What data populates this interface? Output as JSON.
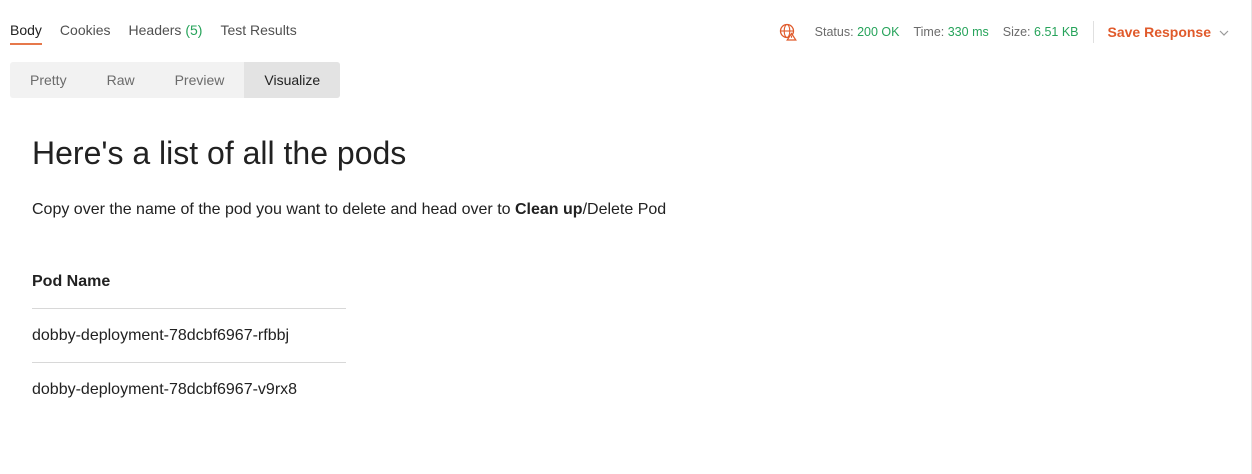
{
  "response_tabs": [
    {
      "label": "Body",
      "active": true
    },
    {
      "label": "Cookies",
      "active": false
    },
    {
      "label": "Headers",
      "count": "(5)",
      "active": false
    },
    {
      "label": "Test Results",
      "active": false
    }
  ],
  "status": {
    "status_label": "Status:",
    "status_value": "200 OK",
    "time_label": "Time:",
    "time_value": "330 ms",
    "size_label": "Size:",
    "size_value": "6.51 KB",
    "icon": "globe-warning-icon"
  },
  "save_response": {
    "label": "Save Response",
    "icon": "chevron-down-icon"
  },
  "view_tabs": [
    {
      "label": "Pretty",
      "active": false
    },
    {
      "label": "Raw",
      "active": false
    },
    {
      "label": "Preview",
      "active": false
    },
    {
      "label": "Visualize",
      "active": true
    }
  ],
  "visualization": {
    "heading": "Here's a list of all the pods",
    "description_prefix": "Copy over the name of the pod you want to delete and head over to ",
    "description_bold": "Clean up",
    "description_suffix": "/Delete Pod",
    "table": {
      "header": "Pod Name",
      "rows": [
        "dobby-deployment-78dcbf6967-rfbbj",
        "dobby-deployment-78dcbf6967-v9rx8"
      ]
    }
  },
  "colors": {
    "accent": "#e05a2b",
    "success": "#26a35a",
    "tab_underline": "#e6784b"
  }
}
